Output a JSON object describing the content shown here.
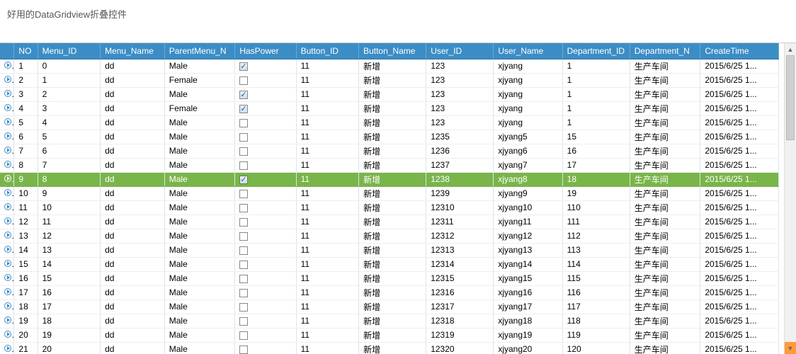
{
  "window": {
    "title": "好用的DataGridview折叠控件"
  },
  "grid": {
    "columns": {
      "no": "NO",
      "menu_id": "Menu_ID",
      "menu_name": "Menu_Name",
      "parentmenu_n": "ParentMenu_N",
      "haspower": "HasPower",
      "button_id": "Button_ID",
      "button_name": "Button_Name",
      "user_id": "User_ID",
      "user_name": "User_Name",
      "department_id": "Department_ID",
      "department_n": "Department_N",
      "createtime": "CreateTime"
    },
    "selected_index": 8,
    "rows": [
      {
        "no": "1",
        "menu_id": "0",
        "menu_name": "dd",
        "parent": "Male",
        "haspower": true,
        "button_id": "11",
        "button_name": "新增",
        "user_id": "123",
        "user_name": "xjyang",
        "dept_id": "1",
        "dept_name": "生产车间",
        "create": "2015/6/25 1..."
      },
      {
        "no": "2",
        "menu_id": "1",
        "menu_name": "dd",
        "parent": "Female",
        "haspower": false,
        "button_id": "11",
        "button_name": "新增",
        "user_id": "123",
        "user_name": "xjyang",
        "dept_id": "1",
        "dept_name": "生产车间",
        "create": "2015/6/25 1..."
      },
      {
        "no": "3",
        "menu_id": "2",
        "menu_name": "dd",
        "parent": "Male",
        "haspower": true,
        "button_id": "11",
        "button_name": "新增",
        "user_id": "123",
        "user_name": "xjyang",
        "dept_id": "1",
        "dept_name": "生产车间",
        "create": "2015/6/25 1..."
      },
      {
        "no": "4",
        "menu_id": "3",
        "menu_name": "dd",
        "parent": "Female",
        "haspower": true,
        "button_id": "11",
        "button_name": "新增",
        "user_id": "123",
        "user_name": "xjyang",
        "dept_id": "1",
        "dept_name": "生产车间",
        "create": "2015/6/25 1..."
      },
      {
        "no": "5",
        "menu_id": "4",
        "menu_name": "dd",
        "parent": "Male",
        "haspower": false,
        "button_id": "11",
        "button_name": "新增",
        "user_id": "123",
        "user_name": "xjyang",
        "dept_id": "1",
        "dept_name": "生产车间",
        "create": "2015/6/25 1..."
      },
      {
        "no": "6",
        "menu_id": "5",
        "menu_name": "dd",
        "parent": "Male",
        "haspower": false,
        "button_id": "11",
        "button_name": "新增",
        "user_id": "1235",
        "user_name": "xjyang5",
        "dept_id": "15",
        "dept_name": "生产车间",
        "create": "2015/6/25 1..."
      },
      {
        "no": "7",
        "menu_id": "6",
        "menu_name": "dd",
        "parent": "Male",
        "haspower": false,
        "button_id": "11",
        "button_name": "新增",
        "user_id": "1236",
        "user_name": "xjyang6",
        "dept_id": "16",
        "dept_name": "生产车间",
        "create": "2015/6/25 1..."
      },
      {
        "no": "8",
        "menu_id": "7",
        "menu_name": "dd",
        "parent": "Male",
        "haspower": false,
        "button_id": "11",
        "button_name": "新增",
        "user_id": "1237",
        "user_name": "xjyang7",
        "dept_id": "17",
        "dept_name": "生产车间",
        "create": "2015/6/25 1..."
      },
      {
        "no": "9",
        "menu_id": "8",
        "menu_name": "dd",
        "parent": "Male",
        "haspower": true,
        "button_id": "11",
        "button_name": "新增",
        "user_id": "1238",
        "user_name": "xjyang8",
        "dept_id": "18",
        "dept_name": "生产车间",
        "create": "2015/6/25 1..."
      },
      {
        "no": "10",
        "menu_id": "9",
        "menu_name": "dd",
        "parent": "Male",
        "haspower": false,
        "button_id": "11",
        "button_name": "新增",
        "user_id": "1239",
        "user_name": "xjyang9",
        "dept_id": "19",
        "dept_name": "生产车间",
        "create": "2015/6/25 1..."
      },
      {
        "no": "11",
        "menu_id": "10",
        "menu_name": "dd",
        "parent": "Male",
        "haspower": false,
        "button_id": "11",
        "button_name": "新增",
        "user_id": "12310",
        "user_name": "xjyang10",
        "dept_id": "110",
        "dept_name": "生产车间",
        "create": "2015/6/25 1..."
      },
      {
        "no": "12",
        "menu_id": "11",
        "menu_name": "dd",
        "parent": "Male",
        "haspower": false,
        "button_id": "11",
        "button_name": "新增",
        "user_id": "12311",
        "user_name": "xjyang11",
        "dept_id": "111",
        "dept_name": "生产车间",
        "create": "2015/6/25 1..."
      },
      {
        "no": "13",
        "menu_id": "12",
        "menu_name": "dd",
        "parent": "Male",
        "haspower": false,
        "button_id": "11",
        "button_name": "新增",
        "user_id": "12312",
        "user_name": "xjyang12",
        "dept_id": "112",
        "dept_name": "生产车间",
        "create": "2015/6/25 1..."
      },
      {
        "no": "14",
        "menu_id": "13",
        "menu_name": "dd",
        "parent": "Male",
        "haspower": false,
        "button_id": "11",
        "button_name": "新增",
        "user_id": "12313",
        "user_name": "xjyang13",
        "dept_id": "113",
        "dept_name": "生产车间",
        "create": "2015/6/25 1..."
      },
      {
        "no": "15",
        "menu_id": "14",
        "menu_name": "dd",
        "parent": "Male",
        "haspower": false,
        "button_id": "11",
        "button_name": "新增",
        "user_id": "12314",
        "user_name": "xjyang14",
        "dept_id": "114",
        "dept_name": "生产车间",
        "create": "2015/6/25 1..."
      },
      {
        "no": "16",
        "menu_id": "15",
        "menu_name": "dd",
        "parent": "Male",
        "haspower": false,
        "button_id": "11",
        "button_name": "新增",
        "user_id": "12315",
        "user_name": "xjyang15",
        "dept_id": "115",
        "dept_name": "生产车间",
        "create": "2015/6/25 1..."
      },
      {
        "no": "17",
        "menu_id": "16",
        "menu_name": "dd",
        "parent": "Male",
        "haspower": false,
        "button_id": "11",
        "button_name": "新增",
        "user_id": "12316",
        "user_name": "xjyang16",
        "dept_id": "116",
        "dept_name": "生产车间",
        "create": "2015/6/25 1..."
      },
      {
        "no": "18",
        "menu_id": "17",
        "menu_name": "dd",
        "parent": "Male",
        "haspower": false,
        "button_id": "11",
        "button_name": "新增",
        "user_id": "12317",
        "user_name": "xjyang17",
        "dept_id": "117",
        "dept_name": "生产车间",
        "create": "2015/6/25 1..."
      },
      {
        "no": "19",
        "menu_id": "18",
        "menu_name": "dd",
        "parent": "Male",
        "haspower": false,
        "button_id": "11",
        "button_name": "新增",
        "user_id": "12318",
        "user_name": "xjyang18",
        "dept_id": "118",
        "dept_name": "生产车间",
        "create": "2015/6/25 1..."
      },
      {
        "no": "20",
        "menu_id": "19",
        "menu_name": "dd",
        "parent": "Male",
        "haspower": false,
        "button_id": "11",
        "button_name": "新增",
        "user_id": "12319",
        "user_name": "xjyang19",
        "dept_id": "119",
        "dept_name": "生产车间",
        "create": "2015/6/25 1..."
      },
      {
        "no": "21",
        "menu_id": "20",
        "menu_name": "dd",
        "parent": "Male",
        "haspower": false,
        "button_id": "11",
        "button_name": "新增",
        "user_id": "12320",
        "user_name": "xjyang20",
        "dept_id": "120",
        "dept_name": "生产车间",
        "create": "2015/6/25 1..."
      }
    ]
  }
}
